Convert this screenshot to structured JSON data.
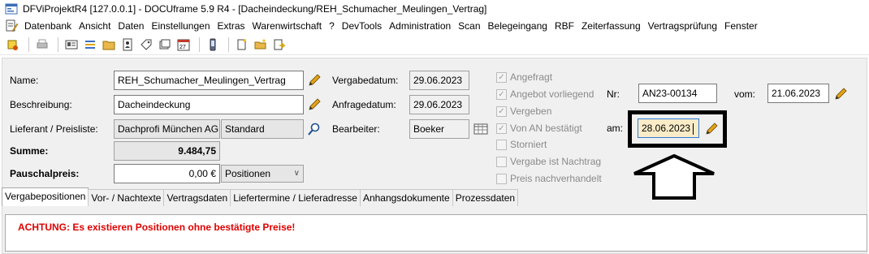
{
  "window": {
    "title": "DFViProjektR4 [127.0.0.1] - DOCUframe 5.9 R4 - [Dacheindeckung/REH_Schumacher_Meulingen_Vertrag]"
  },
  "menu": {
    "items": [
      "Datenbank",
      "Ansicht",
      "Daten",
      "Einstellungen",
      "Extras",
      "Warenwirtschaft",
      "?",
      "DevTools",
      "Administration",
      "Scan",
      "Belegeingang",
      "RBF",
      "Zeiterfassung",
      "Vertragsprüfung",
      "Fenster"
    ]
  },
  "form": {
    "name_label": "Name:",
    "name_value": "REH_Schumacher_Meulingen_Vertrag",
    "beschreibung_label": "Beschreibung:",
    "beschreibung_value": "Dacheindeckung",
    "lieferant_label": "Lieferant / Preisliste:",
    "lieferant_value": "Dachprofi München AG",
    "preisliste_value": "Standard",
    "summe_label": "Summe:",
    "summe_value": "9.484,75",
    "pauschal_label": "Pauschalpreis:",
    "pauschal_value": "0,00 €",
    "pauschal_select": "Positionen",
    "vergabedatum_label": "Vergabedatum:",
    "vergabedatum_value": "29.06.2023",
    "anfragedatum_label": "Anfragedatum:",
    "anfragedatum_value": "29.06.2023",
    "bearbeiter_label": "Bearbeiter:",
    "bearbeiter_value": "Boeker",
    "nr_label": "Nr:",
    "nr_value": "AN23-00134",
    "vom_label": "vom:",
    "vom_value": "21.06.2023",
    "am_label": "am:",
    "am_value": "28.06.2023"
  },
  "checkboxes": [
    {
      "label": "Angefragt",
      "checked": true
    },
    {
      "label": "Angebot vorliegend",
      "checked": true
    },
    {
      "label": "Vergeben",
      "checked": true
    },
    {
      "label": "Von AN bestätigt",
      "checked": true
    },
    {
      "label": "Storniert",
      "checked": false
    },
    {
      "label": "Vergabe ist Nachtrag",
      "checked": false
    },
    {
      "label": "Preis nachverhandelt",
      "checked": false
    }
  ],
  "tabs": [
    "Vergabepositionen",
    "Vor- / Nachtexte",
    "Vertragsdaten",
    "Liefertermine / Lieferadresse",
    "Anhangsdokumente",
    "Prozessdaten"
  ],
  "warning": "ACHTUNG: Es existieren Positionen ohne bestätigte Preise!",
  "colors": {
    "warning": "#e00000",
    "am_highlight_fill": "#fbecc8",
    "am_highlight_border": "#2d7bd6"
  }
}
